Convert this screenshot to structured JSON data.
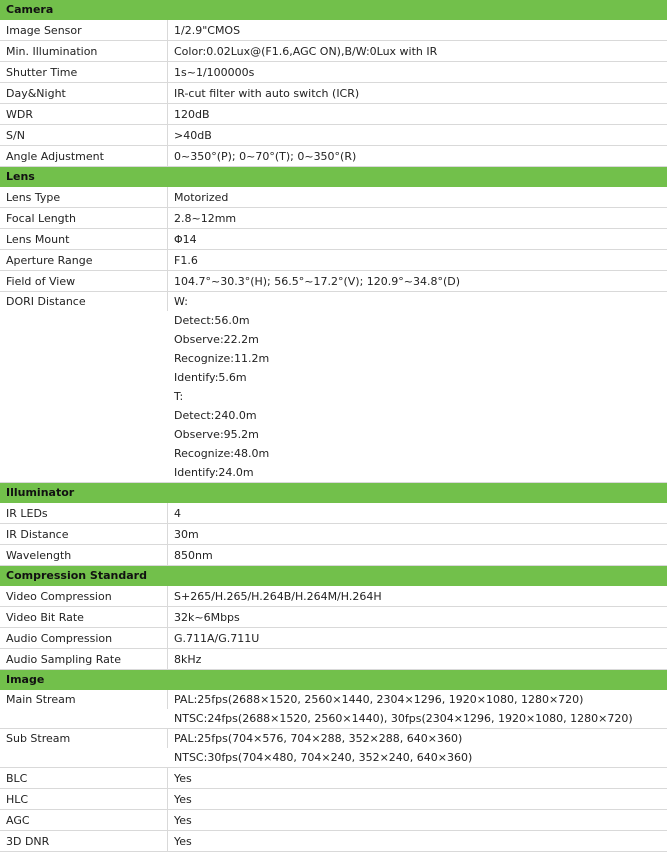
{
  "sections": [
    {
      "title": "Camera",
      "rows": [
        {
          "label": "Image Sensor",
          "values": [
            "1/2.9\"CMOS"
          ]
        },
        {
          "label": "Min. Illumination",
          "values": [
            "Color:0.02Lux@(F1.6,AGC ON),B/W:0Lux with IR"
          ]
        },
        {
          "label": "Shutter Time",
          "values": [
            "1s~1/100000s"
          ]
        },
        {
          "label": "Day&Night",
          "values": [
            "IR-cut filter with auto switch (ICR)"
          ]
        },
        {
          "label": "WDR",
          "values": [
            "120dB"
          ]
        },
        {
          "label": "S/N",
          "values": [
            ">40dB"
          ]
        },
        {
          "label": "Angle Adjustment",
          "values": [
            "0~350°(P); 0~70°(T); 0~350°(R)"
          ]
        }
      ]
    },
    {
      "title": "Lens",
      "rows": [
        {
          "label": "Lens Type",
          "values": [
            "Motorized"
          ]
        },
        {
          "label": "Focal Length",
          "values": [
            "2.8~12mm"
          ]
        },
        {
          "label": "Lens Mount",
          "values": [
            "Φ14"
          ]
        },
        {
          "label": "Aperture Range",
          "values": [
            "F1.6"
          ]
        },
        {
          "label": "Field of View",
          "values": [
            "104.7°~30.3°(H); 56.5°~17.2°(V); 120.9°~34.8°(D)"
          ]
        },
        {
          "label": "DORI Distance",
          "values": [
            "W:",
            "Detect:56.0m",
            "Observe:22.2m",
            "Recognize:11.2m",
            "Identify:5.6m",
            "T:",
            "Detect:240.0m",
            "Observe:95.2m",
            "Recognize:48.0m",
            "Identify:24.0m"
          ]
        }
      ]
    },
    {
      "title": "Illuminator",
      "rows": [
        {
          "label": "IR LEDs",
          "values": [
            "4"
          ]
        },
        {
          "label": "IR Distance",
          "values": [
            "30m"
          ]
        },
        {
          "label": "Wavelength",
          "values": [
            "850nm"
          ]
        }
      ]
    },
    {
      "title": "Compression Standard",
      "rows": [
        {
          "label": "Video Compression",
          "values": [
            "S+265/H.265/H.264B/H.264M/H.264H"
          ]
        },
        {
          "label": "Video Bit Rate",
          "values": [
            "32k~6Mbps"
          ]
        },
        {
          "label": "Audio Compression",
          "values": [
            "G.711A/G.711U"
          ]
        },
        {
          "label": "Audio Sampling Rate",
          "values": [
            "8kHz"
          ]
        }
      ]
    },
    {
      "title": "Image",
      "rows": [
        {
          "label": "Main Stream",
          "values": [
            "PAL:25fps(2688×1520, 2560×1440, 2304×1296, 1920×1080, 1280×720)",
            "NTSC:24fps(2688×1520, 2560×1440), 30fps(2304×1296, 1920×1080, 1280×720)"
          ]
        },
        {
          "label": "Sub Stream",
          "values": [
            "PAL:25fps(704×576, 704×288, 352×288, 640×360)",
            "NTSC:30fps(704×480, 704×240, 352×240, 640×360)"
          ]
        },
        {
          "label": "BLC",
          "values": [
            "Yes"
          ]
        },
        {
          "label": "HLC",
          "values": [
            "Yes"
          ]
        },
        {
          "label": "AGC",
          "values": [
            "Yes"
          ]
        },
        {
          "label": "3D DNR",
          "values": [
            "Yes"
          ]
        }
      ]
    }
  ]
}
